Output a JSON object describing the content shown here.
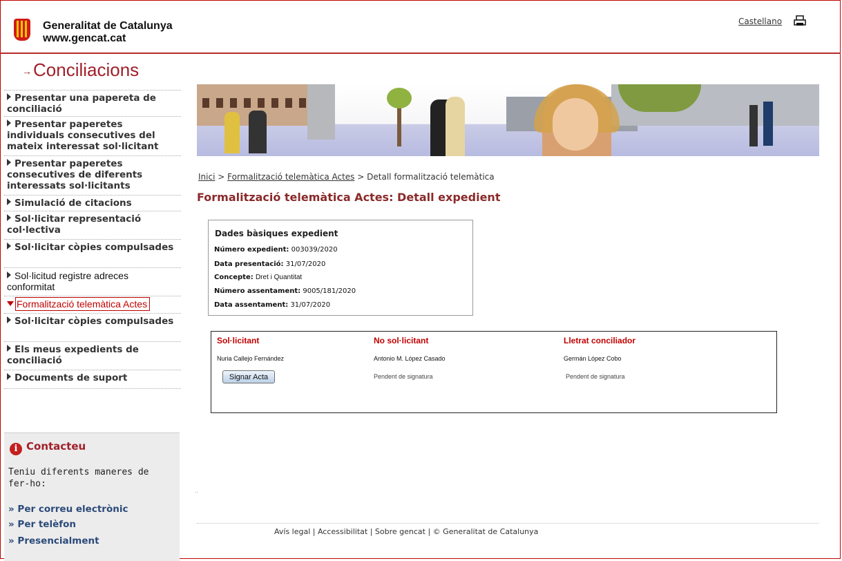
{
  "header": {
    "org_name": "Generalitat de Catalunya",
    "org_url": "www.gencat.cat",
    "language_link": "Castellano",
    "print_icon": "printer-icon",
    "brand_color": "#c00000"
  },
  "section": {
    "title": "Conciliacions"
  },
  "sidebar": {
    "items": [
      {
        "label": "Presentar una papereta de conciliació"
      },
      {
        "label": "Presentar paperetes individuals consecutives del mateix interessat sol·licitant"
      },
      {
        "label": "Presentar paperetes consecutives de diferents interessats sol·licitants"
      },
      {
        "label": "Simulació de citacions"
      },
      {
        "label": "Sol·licitar representació col·lectiva"
      },
      {
        "label": "Sol·licitar còpies compulsades"
      },
      {
        "label": "Sol·licitud registre adreces conformitat"
      },
      {
        "label": "Formalització telemàtica Actes"
      },
      {
        "label": "Sol·licitar còpies compulsades"
      },
      {
        "label": "Els meus expedients de conciliació"
      },
      {
        "label": "Documents de suport"
      }
    ]
  },
  "contact": {
    "title": "Contacteu",
    "text": "Teniu diferents maneres de fer-ho:",
    "links": [
      "» Per correu electrònic",
      "» Per telèfon",
      "» Presencialment"
    ]
  },
  "breadcrumb": {
    "home": "Inici",
    "sep": ">",
    "parent": "Formalització telemàtica Actes",
    "current": "Detall formalització telemàtica"
  },
  "main": {
    "title": "Formalització telemàtica Actes: Detall expedient",
    "basic": {
      "title": "Dades bàsiques expedient",
      "rows": [
        {
          "label": "Número expedient:",
          "value": "003039/2020"
        },
        {
          "label": "Data presentació:",
          "value": "31/07/2020"
        },
        {
          "label": "Concepte:",
          "value": "Dret i Quantitat"
        },
        {
          "label": "Número assentament:",
          "value": "9005/181/2020"
        },
        {
          "label": "Data assentament:",
          "value": "31/07/2020"
        }
      ]
    },
    "signatures": {
      "headers": [
        "Sol·licitant",
        "No sol·licitant",
        "Lletrat conciliador"
      ],
      "names": [
        "Nuria Callejo Fernández",
        "Antonio M. López Casado",
        "Germán López Cobo"
      ],
      "sign_button": "Signar Acta",
      "status_no_sol": "Pendent de signatura",
      "status_lletrat": "Pendent de signatura"
    }
  },
  "footer": {
    "text": "Avís legal | Accessibilitat | Sobre gencat | © Generalitat de Catalunya"
  }
}
